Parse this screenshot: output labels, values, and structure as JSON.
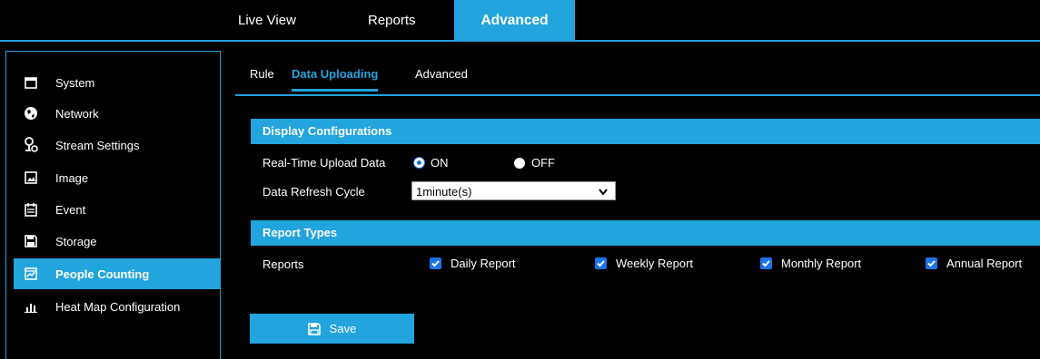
{
  "top_tabs": {
    "live_view": "Live View",
    "reports": "Reports",
    "advanced": "Advanced"
  },
  "sidebar": {
    "items": [
      {
        "label": "System",
        "icon": "window-icon"
      },
      {
        "label": "Network",
        "icon": "globe-icon"
      },
      {
        "label": "Stream Settings",
        "icon": "stream-icon"
      },
      {
        "label": "Image",
        "icon": "image-icon"
      },
      {
        "label": "Event",
        "icon": "calendar-icon"
      },
      {
        "label": "Storage",
        "icon": "floppy-icon"
      },
      {
        "label": "People Counting",
        "icon": "chart-icon",
        "active": true
      },
      {
        "label": "Heat Map Configuration",
        "icon": "bar-chart-icon"
      }
    ]
  },
  "sub_tabs": {
    "rule": "Rule",
    "data_uploading": "Data Uploading",
    "advanced": "Advanced"
  },
  "display_config": {
    "header": "Display Configurations",
    "realtime_label": "Real-Time Upload Data",
    "on_label": "ON",
    "off_label": "OFF",
    "selected": "ON",
    "refresh_label": "Data Refresh Cycle",
    "refresh_value": "1minute(s)"
  },
  "report_types": {
    "header": "Report Types",
    "reports_label": "Reports",
    "daily": "Daily Report",
    "weekly": "Weekly Report",
    "monthly": "Monthly Report",
    "annual": "Annual Report"
  },
  "save_label": "Save",
  "colors": {
    "accent": "#22a4dd",
    "check": "#1a73e8",
    "background": "#000000"
  }
}
